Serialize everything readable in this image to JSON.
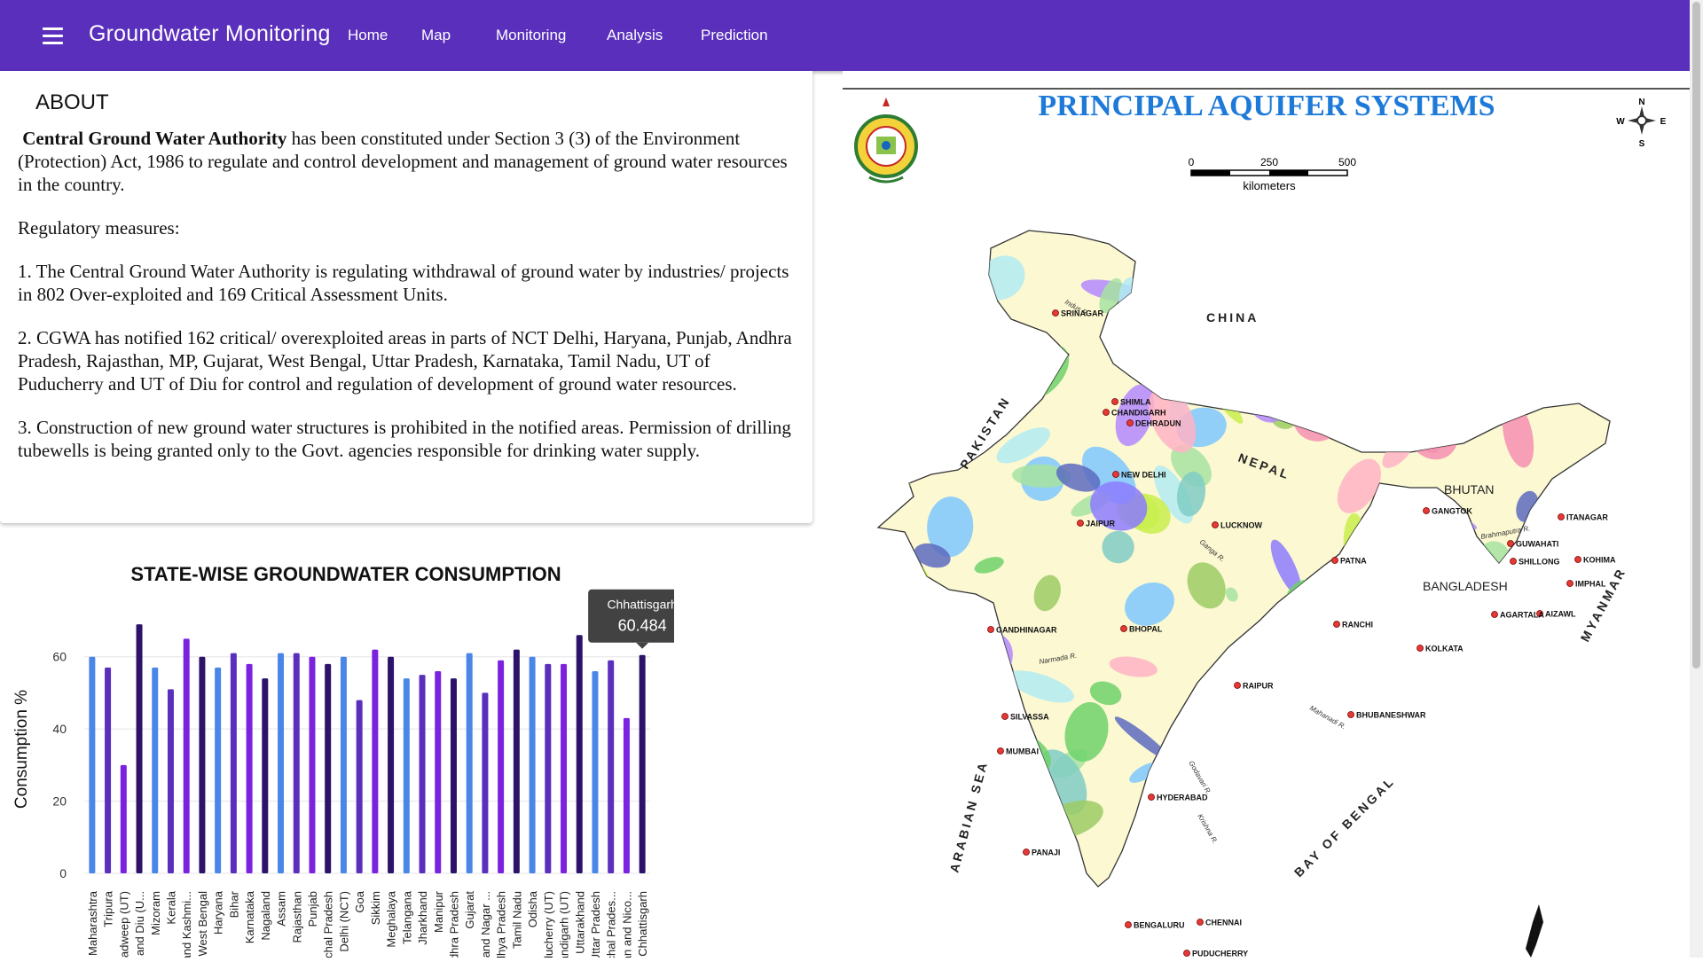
{
  "header": {
    "app_title": "Groundwater Monitoring",
    "nav": [
      "Home",
      "Map",
      "Monitoring",
      "Analysis",
      "Prediction"
    ]
  },
  "about": {
    "title": "ABOUT",
    "intro_bold": "Central Ground Water Authority",
    "intro_rest": " has been constituted under Section 3 (3) of the Environment (Protection) Act, 1986 to regulate and control development and management of ground water resources in the country.",
    "measures_heading": "Regulatory measures:",
    "measures": [
      " 1. The Central Ground Water Authority is regulating withdrawal of ground water by industries/ projects in 802 Over-exploited and 169 Critical Assessment Units.",
      " 2. CGWA has notified 162 critical/ overexploited areas in parts of NCT Delhi, Haryana, Punjab, Andhra Pradesh, Rajasthan, MP, Gujarat, West Bengal, Uttar Pradesh, Karnataka, Tamil Nadu, UT of Puducherry and UT of Diu for control and regulation of development of ground water resources.",
      " 3. Construction of new ground water structures is prohibited in the notified areas. Permission of drilling tubewells is being granted only to the Govt. agencies responsible for drinking water supply."
    ]
  },
  "chart_data": {
    "type": "bar",
    "title": "STATE-WISE GROUNDWATER CONSUMPTION",
    "ylabel": "Consumption %",
    "xlabel": "",
    "ylim": [
      0,
      70
    ],
    "yticks": [
      0,
      20,
      40,
      60
    ],
    "grid": true,
    "categories": [
      "Maharashtra",
      "Tripura",
      "Lakshadweep (UT)",
      "Daman and Diu (U...",
      "Mizoram",
      "Kerala",
      "Jammu and Kashmi...",
      "West Bengal",
      "Haryana",
      "Bihar",
      "Karnataka",
      "Nagaland",
      "Assam",
      "Rajasthan",
      "Punjab",
      "Himachal Pradesh",
      "Delhi (NCT)",
      "Goa",
      "Sikkim",
      "Meghalaya",
      "Telangana",
      "Jharkhand",
      "Manipur",
      "Andhra Pradesh",
      "Gujarat",
      "Dadra and Nagar ...",
      "Madhya Pradesh",
      "Tamil Nadu",
      "Odisha",
      "Puducherry (UT)",
      "Chandigarh (UT)",
      "Uttarakhand",
      "Uttar Pradesh",
      "Arunachal Prades...",
      "Andaman and Nico...",
      "Chhattisgarh"
    ],
    "values": [
      60,
      57,
      30,
      69,
      57,
      51,
      65,
      60,
      57,
      61,
      58,
      54,
      61,
      61,
      60,
      58,
      60,
      48,
      62,
      60,
      54,
      55,
      56,
      54,
      61,
      50,
      59,
      62,
      60,
      58,
      58,
      66,
      56,
      59,
      43,
      60.484
    ],
    "colors": [
      "#4a86e8",
      "#5a2fbc",
      "#7b22e0",
      "#2c1369"
    ],
    "tooltip": {
      "label": "Chhattisgarh",
      "value": "60.484"
    }
  },
  "map": {
    "title": "PRINCIPAL AQUIFER SYSTEMS",
    "scale_labels": [
      "0",
      "250",
      "500"
    ],
    "scale_unit": "kilometers",
    "compass": [
      "N",
      "E",
      "S",
      "W"
    ],
    "countries": [
      "CHINA",
      "PAKISTAN",
      "NEPAL",
      "BHUTAN",
      "BANGLADESH",
      "MYANMAR"
    ],
    "seas": [
      "ARABIAN SEA",
      "BAY OF BENGAL"
    ],
    "rivers": [
      "Indus R.",
      "Ganga R.",
      "Narmada R.",
      "Brahmaputra R.",
      "Mahanadi R.",
      "Godavari R.",
      "Krishna R."
    ],
    "cities": [
      "SRINAGAR",
      "SHIMLA",
      "CHANDIGARH",
      "DEHRADUN",
      "NEW DELHI",
      "JAIPUR",
      "LUCKNOW",
      "GANGTOK",
      "ITANAGAR",
      "GUWAHATI",
      "SHILLONG",
      "KOHIMA",
      "IMPHAL",
      "AIZAWL",
      "AGARTALA",
      "PATNA",
      "RANCHI",
      "KOLKATA",
      "GANDHINAGAR",
      "BHOPAL",
      "RAIPUR",
      "BHUBANESHWAR",
      "SILVASSA",
      "MUMBAI",
      "HYDERABAD",
      "PANAJI",
      "BENGALURU",
      "CHENNAI",
      "PUDUCHERRY"
    ]
  }
}
